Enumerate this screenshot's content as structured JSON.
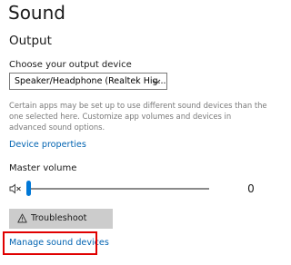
{
  "page": {
    "title": "Sound",
    "section_title": "Output"
  },
  "output": {
    "device_label": "Choose your output device",
    "device_selected": "Speaker/Headphone (Realtek Hig...",
    "info_text": "Certain apps may be set up to use different sound devices than the one selected here. Customize app volumes and devices in advanced sound options.",
    "device_properties_link": "Device properties",
    "master_volume_label": "Master volume",
    "volume_value": "0",
    "troubleshoot_label": "Troubleshoot",
    "manage_devices_link": "Manage sound devices"
  },
  "icons": {
    "select": "chevron-down-icon",
    "volume": "speaker-muted-icon",
    "troubleshoot": "warning-icon"
  },
  "colors": {
    "link": "#0063b1",
    "accent": "#0078d7",
    "highlight": "#e00000",
    "button_bg": "#cccccc",
    "secondary_text": "#7a7a7a"
  }
}
